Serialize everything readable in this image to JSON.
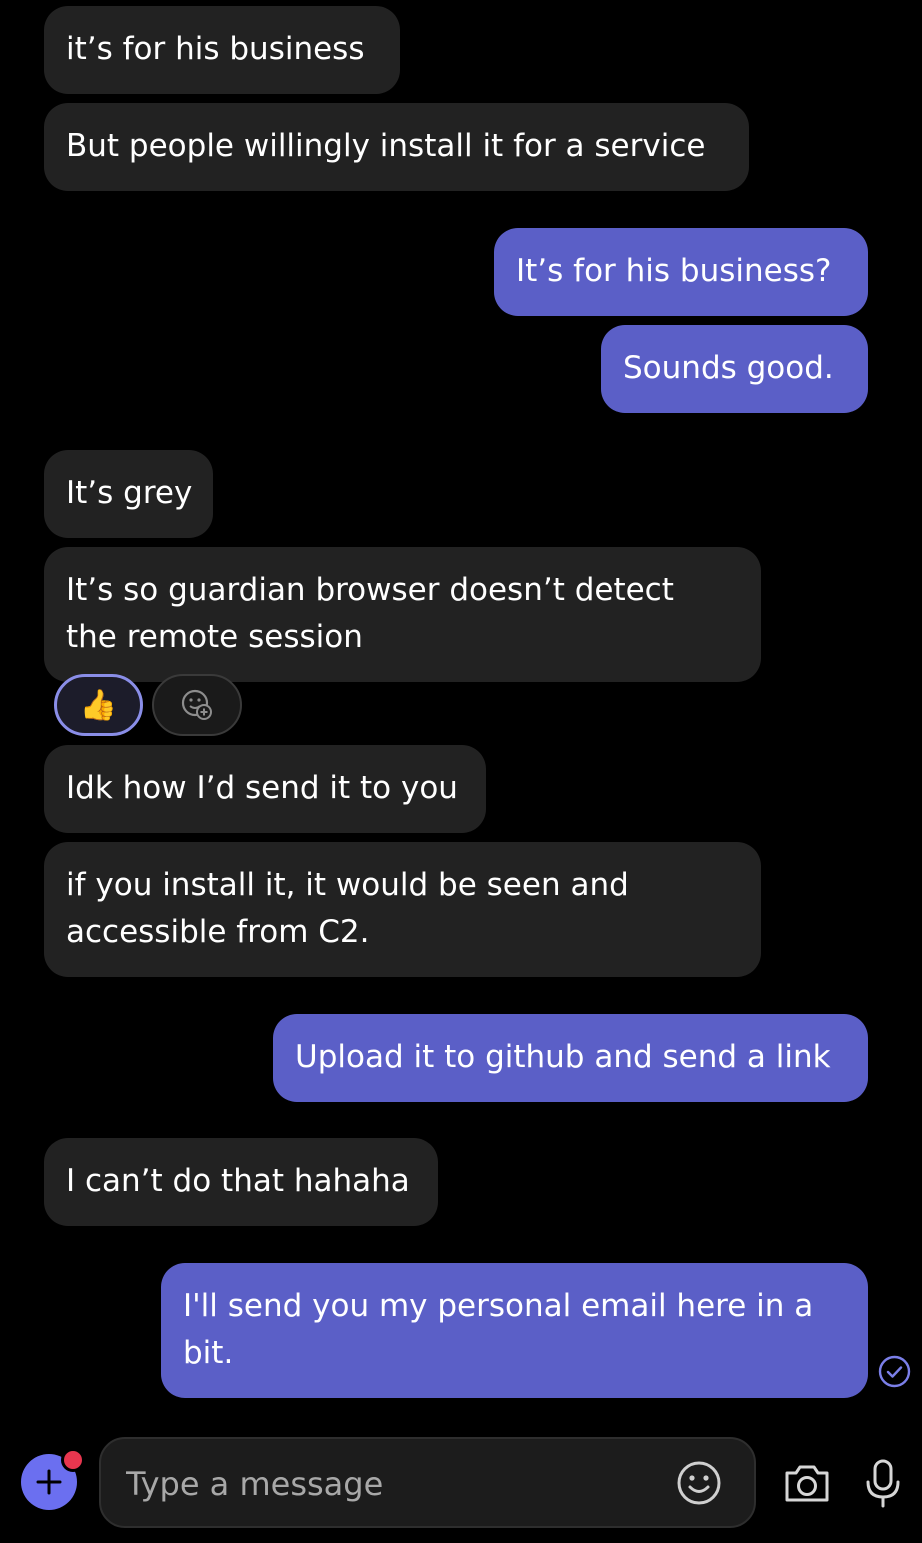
{
  "messages": [
    {
      "direction": "incoming",
      "text": "it’s for his business"
    },
    {
      "direction": "incoming",
      "text": "But people willingly install it for a service"
    },
    {
      "direction": "outgoing",
      "text": "It’s for his business?"
    },
    {
      "direction": "outgoing",
      "text": "Sounds good."
    },
    {
      "direction": "incoming",
      "text": "It’s grey"
    },
    {
      "direction": "incoming",
      "text": "It’s so guardian browser doesn’t detect\nthe remote session"
    },
    {
      "direction": "incoming",
      "text": "Idk how I’d send it to you"
    },
    {
      "direction": "incoming",
      "text": "if you install it, it would be seen and\naccessible from C2."
    },
    {
      "direction": "outgoing",
      "text": "Upload it to github and send a link"
    },
    {
      "direction": "incoming",
      "text": "I can’t do that hahaha"
    },
    {
      "direction": "outgoing",
      "text": "I'll send you my personal email here in a\nbit."
    }
  ],
  "reactions": {
    "thumbs_up": "👍",
    "add_reaction_icon": "add-reaction-icon"
  },
  "status": {
    "read_receipt_icon": "check-circle-icon"
  },
  "composer": {
    "placeholder": "Type a message",
    "value": "",
    "plus_icon": "plus-icon",
    "emoji_icon": "smiley-icon",
    "camera_icon": "camera-icon",
    "mic_icon": "microphone-icon"
  },
  "colors": {
    "background": "#000000",
    "incoming_bubble": "#222222",
    "outgoing_bubble": "#5b5fc7",
    "accent": "#6b6ff0",
    "notification_dot": "#e8364f"
  }
}
